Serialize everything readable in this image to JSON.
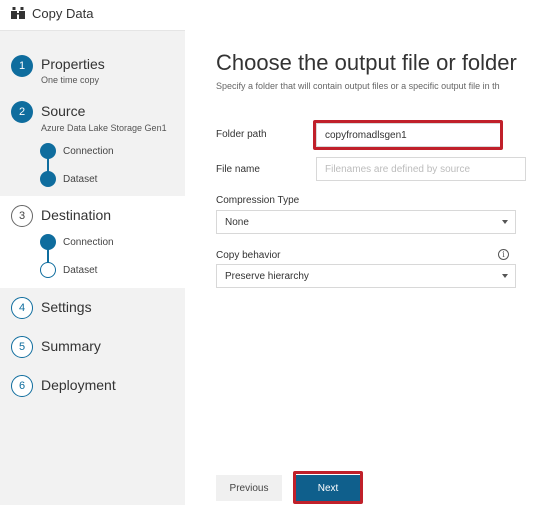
{
  "window": {
    "title": "Copy Data",
    "icon": "copy-data-icon"
  },
  "steps": [
    {
      "number": "1",
      "title": "Properties",
      "subtitle": "One time copy"
    },
    {
      "number": "2",
      "title": "Source",
      "subtitle": "Azure Data Lake Storage Gen1",
      "items": [
        "Connection",
        "Dataset"
      ]
    },
    {
      "number": "3",
      "title": "Destination",
      "items": [
        "Connection",
        "Dataset"
      ]
    },
    {
      "number": "4",
      "title": "Settings"
    },
    {
      "number": "5",
      "title": "Summary"
    },
    {
      "number": "6",
      "title": "Deployment"
    }
  ],
  "main": {
    "title": "Choose the output file or folder",
    "description": "Specify a folder that will contain output files or a specific output file in th",
    "folder_path": {
      "label": "Folder path",
      "value": "copyfromadlsgen1"
    },
    "file_name": {
      "label": "File name",
      "placeholder": "Filenames are defined by source"
    },
    "compression": {
      "label": "Compression Type",
      "value": "None"
    },
    "copy_behavior": {
      "label": "Copy behavior",
      "value": "Preserve hierarchy",
      "info_icon": "info-icon"
    }
  },
  "buttons": {
    "previous": "Previous",
    "next": "Next"
  },
  "colors": {
    "accent": "#0f6d9e",
    "highlight": "#c0202a",
    "next_button": "#0f5f8c"
  }
}
